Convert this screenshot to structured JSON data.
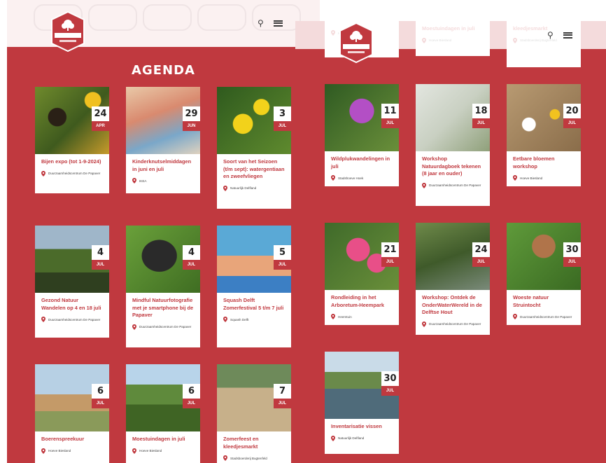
{
  "colors": {
    "brand_red": "#c0393f",
    "card_bg": "#ffffff",
    "date_day_text": "#222222"
  },
  "left": {
    "heading": "AGENDA",
    "logo": {
      "name": "DELFTSE HOUT",
      "url": "www.delftsehout.nl"
    },
    "cards": [
      {
        "day": "24",
        "month": "APR",
        "title": "Bijen expo (tot 1-9-2024)",
        "location": "Duurzaamheidscentrum De Papaver"
      },
      {
        "day": "29",
        "month": "JUN",
        "title": "Kinderknutselmiddagen in juni en juli",
        "location": "IKEA"
      },
      {
        "day": "3",
        "month": "JUL",
        "title": "Soort van het Seizoen (t/m sept): watergentiaan en zweefvliegen",
        "location": "Natuurlijk Delfland"
      },
      {
        "day": "4",
        "month": "JUL",
        "title": "Gezond Natuur Wandelen op 4 en 18 juli",
        "location": "Duurzaamheidscentrum De Papaver"
      },
      {
        "day": "4",
        "month": "JUL",
        "title": "Mindful Natuurfotografie met je smartphone bij de Papaver",
        "location": "Duurzaamheidscentrum De Papaver"
      },
      {
        "day": "5",
        "month": "JUL",
        "title": "Squash Delft Zomerfestival 5 t/m 7 juli",
        "location": "Squash Delft"
      },
      {
        "day": "6",
        "month": "JUL",
        "title": "Boerenspreekuur",
        "location": "Hoeve Biesland"
      },
      {
        "day": "6",
        "month": "JUL",
        "title": "Moestuindagen in juli",
        "location": "Hoeve Biesland"
      },
      {
        "day": "7",
        "month": "JUL",
        "title": "Zomerfeest en kleedjesmarkt",
        "location": "Stadsboerderij Bugtenfeld"
      }
    ]
  },
  "right": {
    "partial_cards": [
      {
        "title": "",
        "location": "Hoeve Biesland"
      },
      {
        "title": "Moestuindagen in juli",
        "location": "Hoeve Biesland"
      },
      {
        "title": "kleedjesmarkt",
        "location": "Stadsboerderij Bugtenfeld"
      }
    ],
    "cards": [
      {
        "day": "11",
        "month": "JUL",
        "title": "Wildplukwandelingen in juli",
        "location": "Stadshoeve Hoek"
      },
      {
        "day": "18",
        "month": "JUL",
        "title": "Workshop Natuurdagboek tekenen (8 jaar en ouder)",
        "location": "Duurzaamheidscentrum De Papaver"
      },
      {
        "day": "20",
        "month": "JUL",
        "title": "Eetbare bloemen workshop",
        "location": "Hoeve Biesland"
      },
      {
        "day": "21",
        "month": "JUL",
        "title": "Rondleiding in het Arboretum-Heempark",
        "location": "Heemtuin"
      },
      {
        "day": "24",
        "month": "JUL",
        "title": "Workshop: Ontdek de OnderWaterWereld in de Delftse Hout",
        "location": "Duurzaamheidscentrum De Papaver"
      },
      {
        "day": "30",
        "month": "JUL",
        "title": "Woeste natuur Struintocht",
        "location": "Duurzaamheidscentrum De Papaver"
      },
      {
        "day": "30",
        "month": "JUL",
        "title": "Inventarisatie vissen",
        "location": "Natuurlijk Delfland"
      }
    ]
  }
}
